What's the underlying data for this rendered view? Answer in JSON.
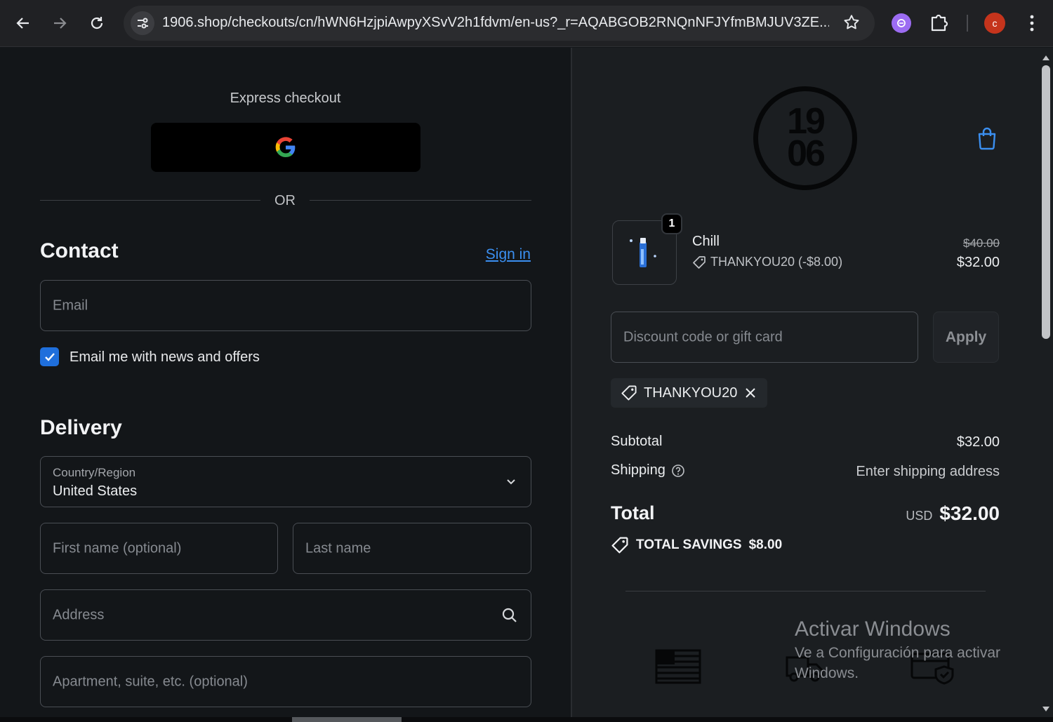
{
  "browser": {
    "url": "1906.shop/checkouts/cn/hWN6HzjpiAwpyXSvV2h1fdvm/en-us?_r=AQABGOB2RNQnNFJYfmBMJUV3ZE...",
    "avatar_letter": "c",
    "icons": [
      "back-icon",
      "forward-icon",
      "reload-icon",
      "site-info-icon",
      "bookmark-star-icon",
      "extension-icon",
      "puzzle-icon",
      "menu-kebab-icon"
    ]
  },
  "express": {
    "title": "Express checkout",
    "or_label": "OR"
  },
  "contact": {
    "heading": "Contact",
    "sign_in": "Sign in",
    "email_placeholder": "Email",
    "newsletter_label": "Email me with news and offers",
    "newsletter_checked": true
  },
  "delivery": {
    "heading": "Delivery",
    "country_label": "Country/Region",
    "country_value": "United States",
    "first_name_placeholder": "First name (optional)",
    "last_name_placeholder": "Last name",
    "address_placeholder": "Address",
    "apartment_placeholder": "Apartment, suite, etc. (optional)"
  },
  "summary": {
    "logo_top": "19",
    "logo_bottom": "06",
    "product": {
      "quantity": "1",
      "name": "Chill",
      "discount": "THANKYOU20 (-$8.00)",
      "original_price": "$40.00",
      "price": "$32.00"
    },
    "discount_placeholder": "Discount code or gift card",
    "apply_label": "Apply",
    "applied_code": "THANKYOU20",
    "subtotal_label": "Subtotal",
    "subtotal_value": "$32.00",
    "shipping_label": "Shipping",
    "shipping_value": "Enter shipping address",
    "total_label": "Total",
    "currency": "USD",
    "total_value": "$32.00",
    "savings_label": "TOTAL SAVINGS",
    "savings_value": "$8.00"
  },
  "watermark": {
    "title": "Activar Windows",
    "subtitle": "Ve a Configuración para activar Windows."
  },
  "colors": {
    "page_bg": "#131619",
    "summary_bg": "#1b1e21",
    "accent": "#1f6fdc",
    "link": "#3b8ff0"
  }
}
